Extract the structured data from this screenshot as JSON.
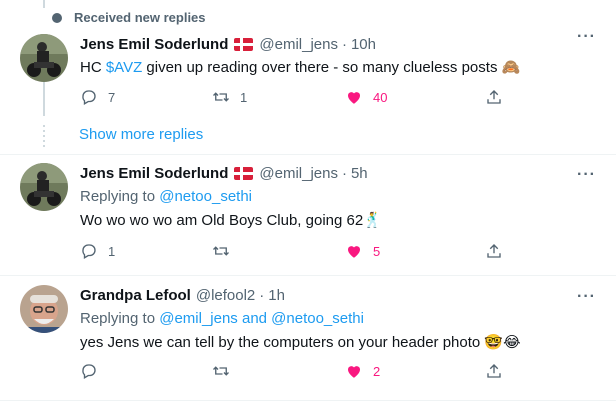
{
  "top_note": "Received new replies",
  "show_more": "Show more replies",
  "tweets": [
    {
      "name": "Jens Emil Soderlund",
      "handle": "@emil_jens",
      "time": "10h",
      "reply_label": "",
      "reply_to": "",
      "text_before": "HC ",
      "cashtag": "$AVZ",
      "text_after": " given up reading over there - so many clueless posts 🙈",
      "replies": "7",
      "retweets": "1",
      "likes": "40"
    },
    {
      "name": "Jens Emil Soderlund",
      "handle": "@emil_jens",
      "time": "5h",
      "reply_label": "Replying to ",
      "reply_to": "@netoo_sethi",
      "text": "Wo wo wo wo am Old Boys Club, going 62🕺",
      "replies": "1",
      "retweets": "",
      "likes": "5"
    },
    {
      "name": "Grandpa Lefool",
      "handle": "@lefool2",
      "time": "1h",
      "reply_label": "Replying to ",
      "reply_to": "@emil_jens and @netoo_sethi",
      "text": "yes Jens we can tell by the computers on your header photo 🤓😂",
      "replies": "",
      "retweets": "",
      "likes": "2"
    }
  ],
  "colors": {
    "accent": "#1d9bf0",
    "like": "#f91880",
    "muted": "#536471"
  }
}
